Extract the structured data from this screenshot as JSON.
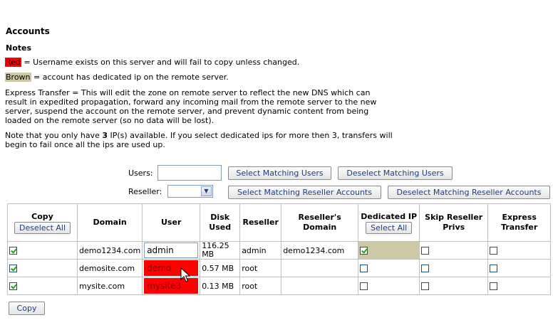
{
  "header": {
    "title": "Accounts"
  },
  "notes": {
    "title": "Notes",
    "red_key": "Red",
    "red_text": " = Username exists on this server and will fail to copy unless changed.",
    "brown_key": "Brown",
    "brown_text": " = account has dedicated ip on the remote server.",
    "express": "Express Transfer = This will edit the zone on remote server to reflect the new DNS which can result in expedited propagation, forward any incoming mail from the remote server to the new server, suspend the account on the remote server, and prevent dynamic content from being loaded on the remote server (so no data will be lost).",
    "ip_prefix": "Note that you only have ",
    "ip_count": "3",
    "ip_suffix": " IP(s) available. If you select dedicated ips for more then 3, transfers will begin to fail once all the ips are used up."
  },
  "filters": {
    "users_label": "Users:",
    "users_value": "",
    "select_matching_users": "Select Matching Users",
    "deselect_matching_users": "Deselect Matching Users",
    "reseller_label": "Reseller:",
    "reseller_value": "",
    "select_matching_reseller": "Select Matching Reseller Accounts",
    "deselect_matching_reseller": "Deselect Matching Reseller Accounts"
  },
  "table": {
    "headers": {
      "copy": "Copy",
      "deselect_all": "Deselect All",
      "domain": "Domain",
      "user": "User",
      "disk_used": "Disk Used",
      "reseller": "Reseller",
      "resellers_domain": "Reseller's Domain",
      "dedicated_ip": "Dedicated IP",
      "select_all": "Select All",
      "skip_reseller_privs": "Skip Reseller Privs",
      "express_transfer": "Express Transfer"
    },
    "rows": [
      {
        "copy": true,
        "domain": "demo1234.com",
        "user": "admin",
        "user_conflict": false,
        "disk_used": "116.25 MB",
        "reseller": "admin",
        "reseller_domain": "demo1234.com",
        "dedicated_ip": true,
        "dedicated_remote": true,
        "skip_privs": false,
        "express": false
      },
      {
        "copy": true,
        "domain": "demosite.com",
        "user": "demo",
        "user_conflict": true,
        "disk_used": "0.57 MB",
        "reseller": "root",
        "reseller_domain": "",
        "dedicated_ip": false,
        "dedicated_remote": false,
        "skip_privs": false,
        "express": false
      },
      {
        "copy": true,
        "domain": "mysite.com",
        "user": "mysite3",
        "user_conflict": true,
        "disk_used": "0.13 MB",
        "reseller": "root",
        "reseller_domain": "",
        "dedicated_ip": false,
        "dedicated_remote": false,
        "skip_privs": false,
        "express": false
      }
    ]
  },
  "footer": {
    "copy_button": "Copy"
  },
  "colors": {
    "conflict_red": "#ff0000",
    "dedicated_brown": "#cdc9a5",
    "button_text": "#1f3d7a"
  }
}
